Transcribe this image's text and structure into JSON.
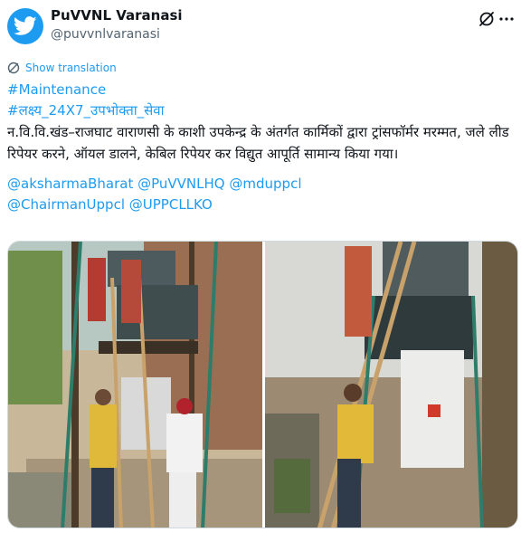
{
  "author": {
    "display_name": "PuVVNL Varanasi",
    "handle": "@puvvnlvaranasi"
  },
  "actions": {
    "translate_label": "Show translation"
  },
  "content": {
    "hashtag1": "#Maintenance",
    "hashtag2": "#लक्ष्य_24X7_उपभोक्ता_सेवा",
    "body": "न.वि.वि.खंड–राजघाट वाराणसी के काशी उपकेन्द्र के अंतर्गत कार्मिकों द्वारा ट्रांसफॉर्मर मरम्मत, जले लीड रिपेयर करने, ऑयल डालने, केबिल रिपेयर कर विद्युत आपूर्ति सामान्य किया गया।",
    "mentions_line1": [
      "@aksharmaBharat",
      "@PuVVNLHQ",
      "@mduppcl"
    ],
    "mentions_line2": [
      "@ChairmanUppcl",
      "@UPPCLLKO"
    ]
  },
  "icons": {
    "avatar": "twitter-bird-icon",
    "grok": "grok-slash-icon",
    "more": "more-dots-icon",
    "translate": "translate-globe-icon"
  },
  "colors": {
    "brand_blue": "#1d9bf0",
    "text": "#0f1419",
    "secondary": "#536471"
  }
}
